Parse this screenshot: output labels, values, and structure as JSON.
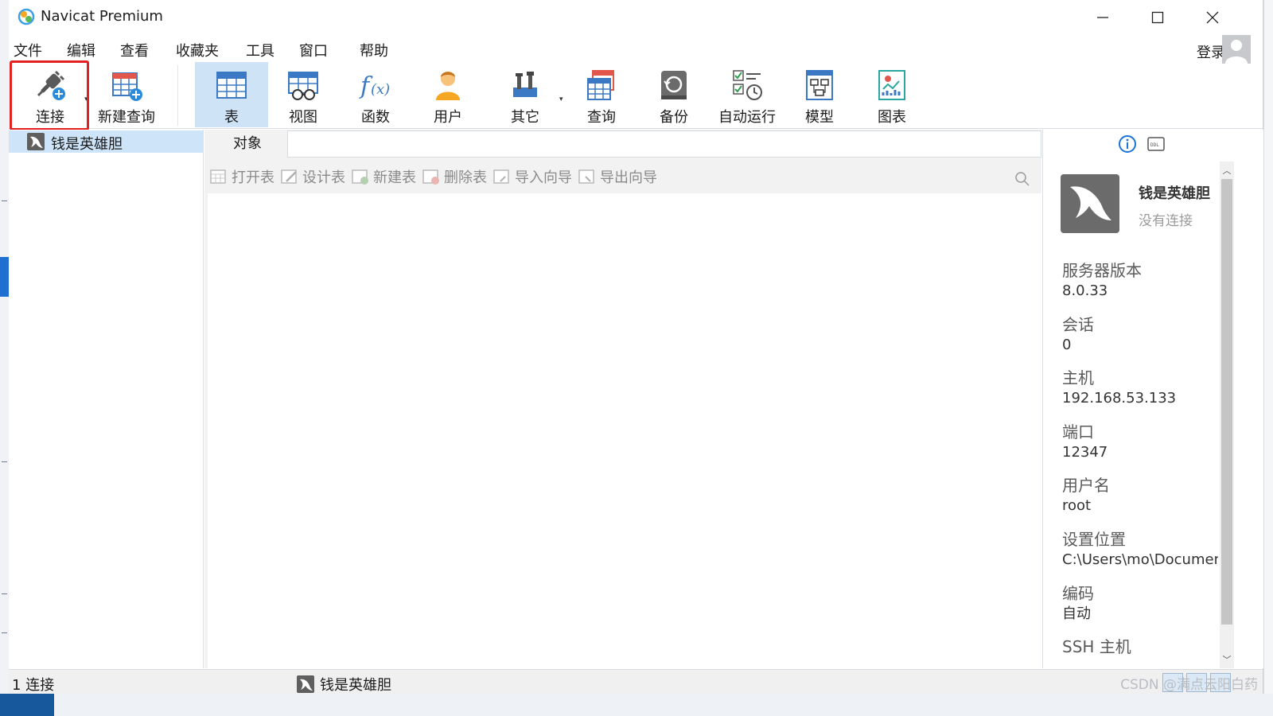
{
  "window": {
    "title": "Navicat Premium"
  },
  "menu": [
    "文件",
    "编辑",
    "查看",
    "收藏夹",
    "工具",
    "窗口",
    "帮助"
  ],
  "login_label": "登录",
  "toolbar": {
    "connect": "连接",
    "new_query": "新建查询",
    "table": "表",
    "view": "视图",
    "function": "函数",
    "user": "用户",
    "other": "其它",
    "query": "查询",
    "backup": "备份",
    "autorun": "自动运行",
    "model": "模型",
    "chart": "图表"
  },
  "navigator": {
    "connection_name": "钱是英雄胆"
  },
  "center": {
    "tab_objects": "对象",
    "actions": {
      "open_table": "打开表",
      "design_table": "设计表",
      "new_table": "新建表",
      "delete_table": "删除表",
      "import_wizard": "导入向导",
      "export_wizard": "导出向导"
    }
  },
  "info": {
    "connection_name": "钱是英雄胆",
    "status": "没有连接",
    "server_version_label": "服务器版本",
    "server_version": "8.0.33",
    "session_label": "会话",
    "session": "0",
    "host_label": "主机",
    "host": "192.168.53.133",
    "port_label": "端口",
    "port": "12347",
    "username_label": "用户名",
    "username": "root",
    "settings_location_label": "设置位置",
    "settings_location": "C:\\Users\\mo\\Documents",
    "encoding_label": "编码",
    "encoding": "自动",
    "ssh_host_label": "SSH 主机"
  },
  "statusbar": {
    "connection_count": "1 连接",
    "current_connection": "钱是英雄胆",
    "watermark": "CSDN @满点云阳白药"
  },
  "colors": {
    "highlight_box": "#e52020",
    "active_tab_bg": "#cfe3f7",
    "selected_row_bg": "#cde4f9",
    "accent_blue": "#1a73d9"
  }
}
